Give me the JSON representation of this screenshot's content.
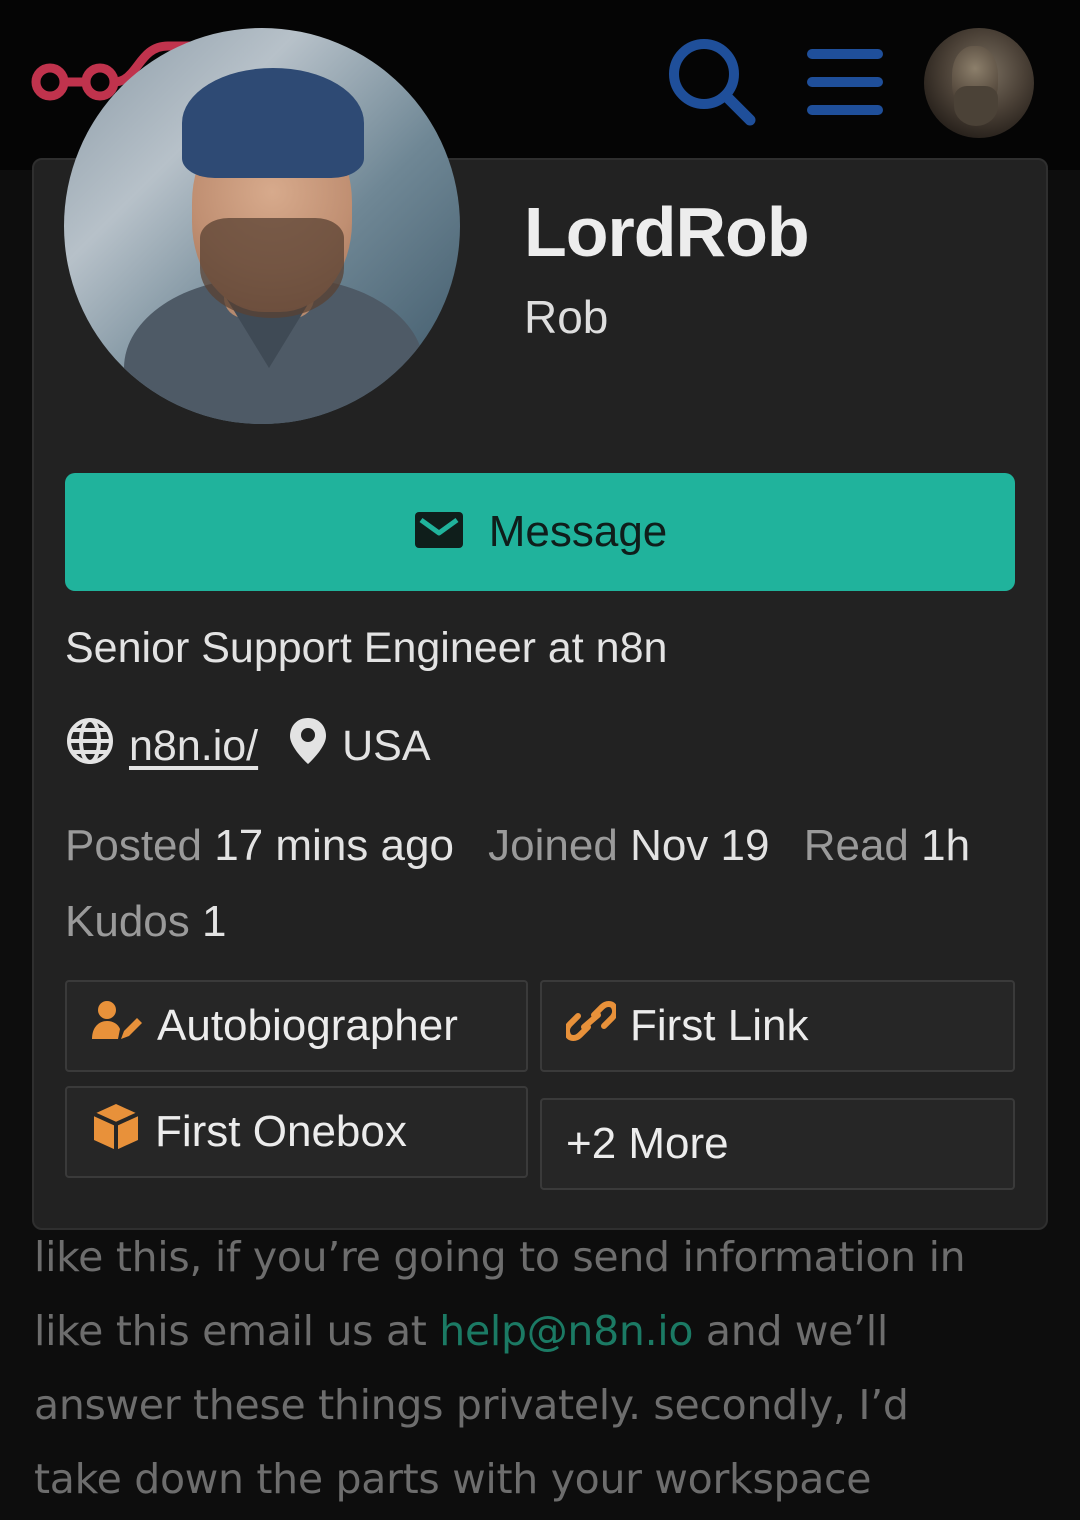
{
  "header": {
    "logo_icon": "n8n-logo-icon",
    "search_icon": "search-icon",
    "menu_icon": "hamburger-menu-icon",
    "avatar_icon": "user-avatar"
  },
  "profile": {
    "username": "LordRob",
    "full_name": "Rob",
    "message_label": "Message",
    "title": "Senior Support Engineer at n8n",
    "website": "n8n.io/",
    "location": "USA",
    "stats": {
      "posted_label": "Posted",
      "posted_value": "17 mins ago",
      "joined_label": "Joined",
      "joined_value": "Nov 19",
      "read_label": "Read",
      "read_value": "1h",
      "kudos_label": "Kudos",
      "kudos_value": "1"
    },
    "badges": [
      {
        "label": "Autobiographer",
        "icon": "user-pen-icon"
      },
      {
        "label": "First Link",
        "icon": "link-icon"
      },
      {
        "label": "First Onebox",
        "icon": "cube-icon"
      },
      {
        "label": "+2 More",
        "icon": ""
      }
    ],
    "accent_color": "#20b39c",
    "badge_icon_color": "#e8913a"
  },
  "background_post": {
    "line1": "like this, if you’re going to send information in",
    "line2_a": "like this email us at ",
    "line2_link": "help@n8n.io",
    "line2_b": " and we’ll",
    "line3": "answer these things privately. secondly, I’d",
    "line4": "take down the parts with your workspace"
  }
}
